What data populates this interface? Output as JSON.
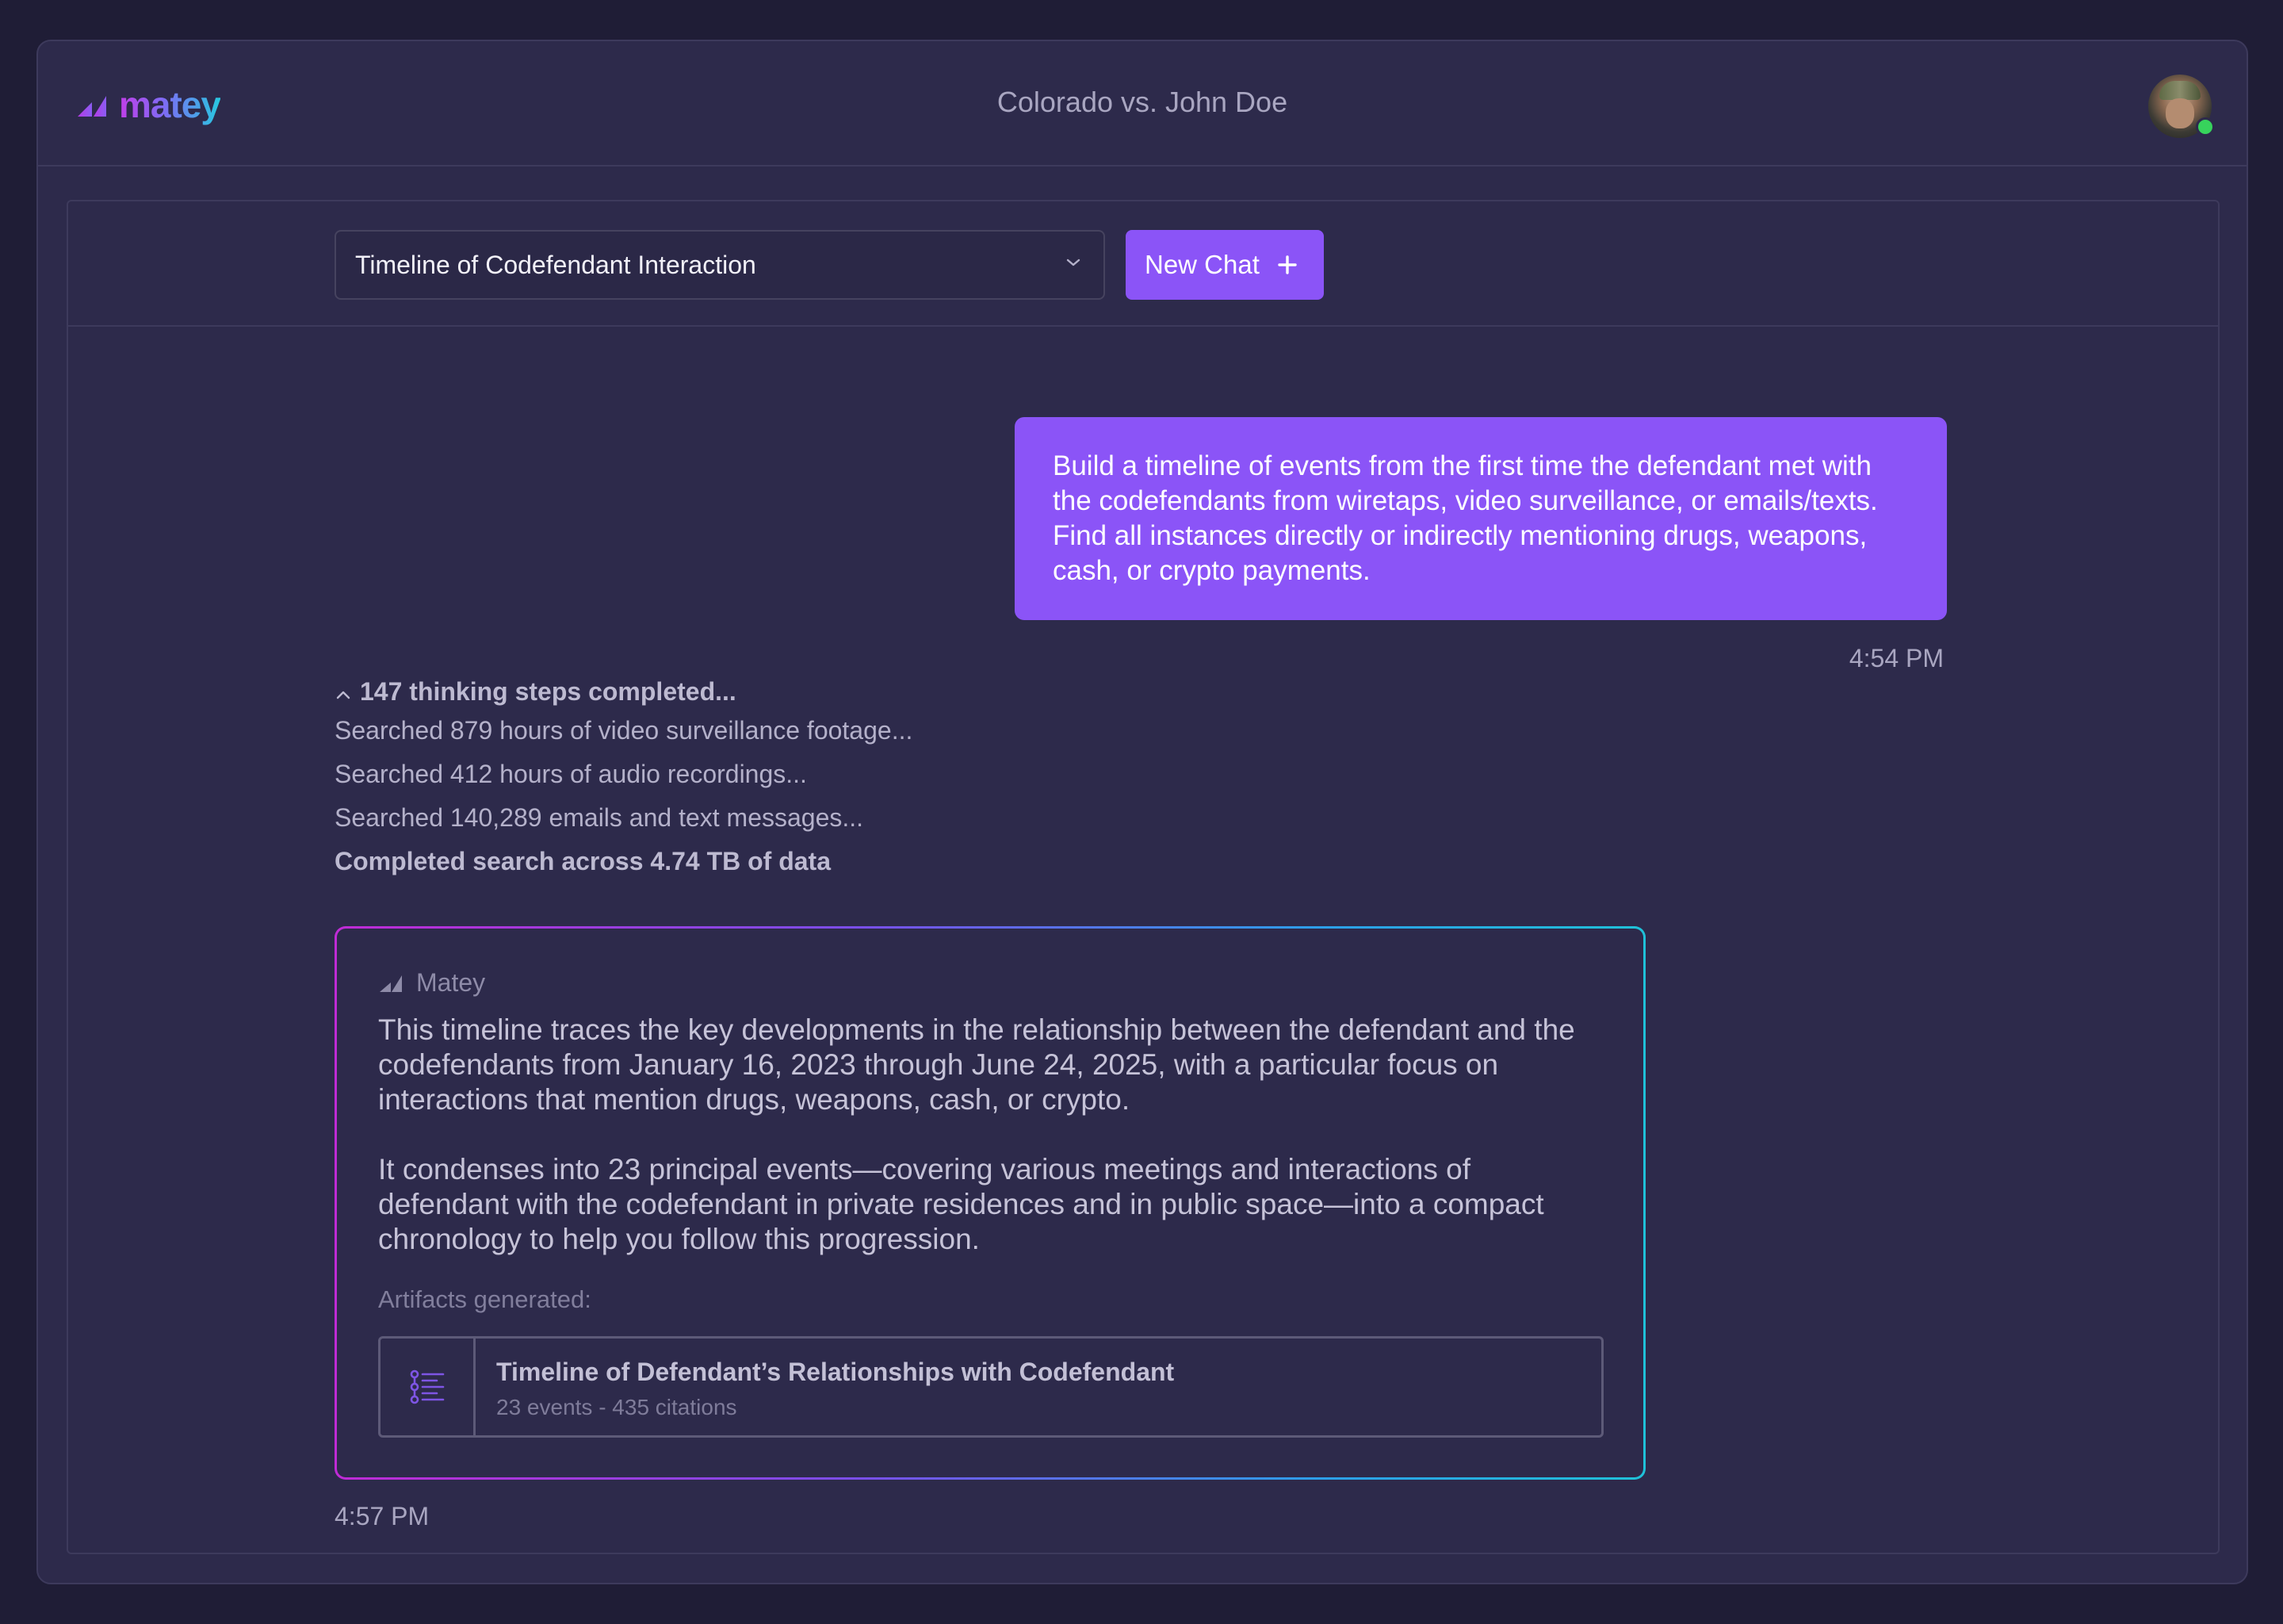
{
  "app": {
    "logo_text": "matey",
    "case_title": "Colorado vs. John Doe",
    "user_status": "online"
  },
  "toolbar": {
    "chat_select_value": "Timeline of Codefendant Interaction",
    "new_chat_label": "New Chat"
  },
  "user_message": {
    "text": "Build a timeline of events from the first time the defendant met with the codefendants from wiretaps, video surveillance, or emails/texts.   Find all instances directly or indirectly mentioning drugs, weapons, cash, or crypto payments.",
    "time": "4:54 PM"
  },
  "thinking": {
    "summary": "147 thinking steps completed...",
    "steps": [
      "Searched 879 hours of video surveillance footage...",
      "Searched 412 hours of audio recordings...",
      "Searched 140,289 emails and text messages..."
    ],
    "completed": "Completed search across 4.74 TB of data"
  },
  "assistant": {
    "name": "Matey",
    "paragraphs": [
      "This timeline traces the key developments in the relationship between the defendant and the codefendants from January 16, 2023 through June 24, 2025, with a particular focus on interactions that mention drugs, weapons, cash, or crypto.",
      "It condenses into 23 principal events—covering various meetings and interactions of defendant with the codefendant in private residences and in public space—into a compact chronology to help you follow this progression."
    ],
    "artifacts_label": "Artifacts generated:",
    "artifact": {
      "title": "Timeline of Defendant’s Relationships with Codefendant",
      "meta": "23 events - 435 citations"
    },
    "time": "4:57 PM"
  },
  "colors": {
    "background": "#1f1d36",
    "window": "#2d2a4b",
    "accent": "#8b54f7",
    "online": "#37d35c"
  }
}
